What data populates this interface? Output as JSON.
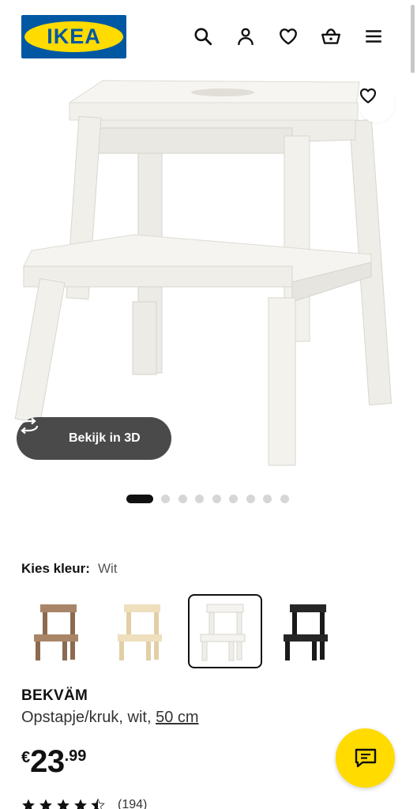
{
  "header": {
    "logo_text": "IKEA",
    "icons": [
      "search-icon",
      "user-icon",
      "heart-icon",
      "basket-icon",
      "menu-icon"
    ]
  },
  "hero": {
    "view_3d_label": "Bekijk in 3D",
    "carousel": {
      "total": 9,
      "active": 1
    }
  },
  "colour": {
    "label": "Kies kleur:",
    "selected": "Wit",
    "options": [
      {
        "color": "#9c7a5e"
      },
      {
        "color": "#ead9b5"
      },
      {
        "color": "#f2f0ea",
        "selected": true
      },
      {
        "color": "#1f1f1f"
      }
    ]
  },
  "product": {
    "name": "BEKVÄM",
    "description": "Opstapje/kruk, wit,",
    "size_link": "50 cm",
    "price": {
      "currency": "€",
      "integer": "23",
      "decimals": ".99"
    },
    "rating": {
      "stars": 4.5,
      "count": "(194)"
    }
  },
  "colors": {
    "brand_blue": "#0058a3",
    "brand_yellow": "#ffdb00"
  }
}
